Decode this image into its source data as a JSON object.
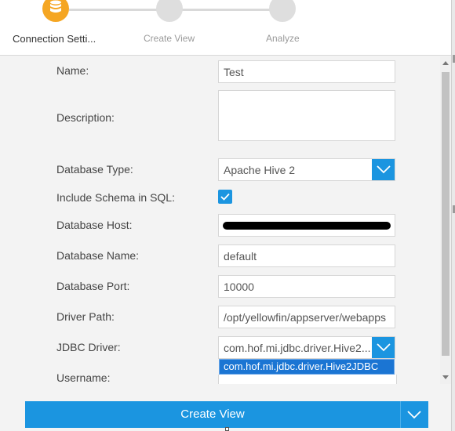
{
  "wizard": {
    "steps": [
      {
        "label": "Connection Setti...",
        "state": "active",
        "icon": "database-icon"
      },
      {
        "label": "Create View",
        "state": "inactive"
      },
      {
        "label": "Analyze",
        "state": "inactive"
      }
    ]
  },
  "form": {
    "name": {
      "label": "Name:",
      "value": "Test"
    },
    "description": {
      "label": "Description:",
      "value": ""
    },
    "database_type": {
      "label": "Database Type:",
      "value": "Apache Hive 2"
    },
    "include_schema": {
      "label": "Include Schema in SQL:",
      "checked": true
    },
    "database_host": {
      "label": "Database Host:",
      "value": "(redacted)"
    },
    "database_name": {
      "label": "Database Name:",
      "value": "default"
    },
    "database_port": {
      "label": "Database Port:",
      "value": "10000"
    },
    "driver_path": {
      "label": "Driver Path:",
      "value": "/opt/yellowfin/appserver/webapps"
    },
    "jdbc_driver": {
      "label": "JDBC Driver:",
      "value": "com.hof.mi.jdbc.driver.Hive2...",
      "options": [
        "com.hof.mi.jdbc.driver.Hive2JDBC"
      ]
    },
    "username": {
      "label": "Username:"
    }
  },
  "actions": {
    "primary_label": "Create View"
  },
  "colors": {
    "accent": "#1b95e0",
    "active_step": "#f5a623",
    "highlight": "#1b75d3"
  }
}
